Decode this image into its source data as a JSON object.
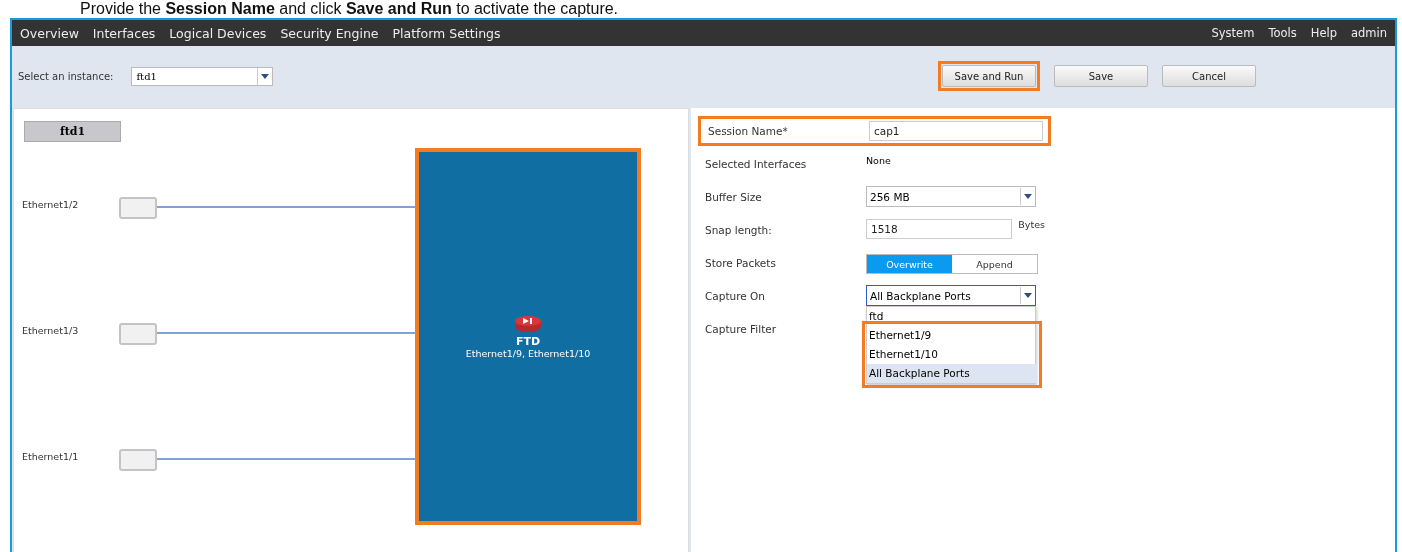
{
  "instruction": "Provide the **Session Name** and click **Save and Run** to activate the capture.",
  "nav": {
    "items": [
      "Overview",
      "Interfaces",
      "Logical Devices",
      "Security Engine",
      "Platform Settings"
    ],
    "right_items": [
      "System",
      "Tools",
      "Help",
      "admin"
    ]
  },
  "toolbar": {
    "instance_label": "Select an instance:",
    "instance_value": "ftd1",
    "buttons": [
      {
        "label": "Save and Run",
        "highlighted": true
      },
      {
        "label": "Save",
        "highlighted": false
      },
      {
        "label": "Cancel",
        "highlighted": false
      }
    ]
  },
  "diagram": {
    "tab": "ftd1",
    "ports": [
      {
        "name": "Ethernet1/2"
      },
      {
        "name": "Ethernet1/3"
      },
      {
        "name": "Ethernet1/1"
      }
    ],
    "device": {
      "name": "FTD",
      "interfaces": "Ethernet1/9, Ethernet1/10",
      "highlighted": true
    }
  },
  "form": {
    "fields": [
      {
        "kind": "text",
        "label": "Session Name*",
        "value": "cap1",
        "highlighted": true
      },
      {
        "kind": "static",
        "label": "Selected Interfaces",
        "value": "None"
      },
      {
        "kind": "select",
        "label": "Buffer Size",
        "value": "256 MB"
      },
      {
        "kind": "text",
        "label": "Snap length:",
        "value": "1518",
        "unit": "Bytes"
      },
      {
        "kind": "toggle",
        "label": "Store Packets",
        "options": [
          {
            "label": "Overwrite",
            "selected": true
          },
          {
            "label": "Append",
            "selected": false
          }
        ]
      },
      {
        "kind": "select",
        "label": "Capture On",
        "value": "All Backplane Ports",
        "focused": true,
        "dropdown": [
          {
            "label": "ftd",
            "selected": false,
            "framed": false
          },
          {
            "label": "Ethernet1/9",
            "selected": false,
            "framed": true
          },
          {
            "label": "Ethernet1/10",
            "selected": false,
            "framed": true
          },
          {
            "label": "All Backplane Ports",
            "selected": true,
            "framed": true
          }
        ]
      },
      {
        "kind": "label",
        "label": "Capture Filter"
      }
    ]
  }
}
